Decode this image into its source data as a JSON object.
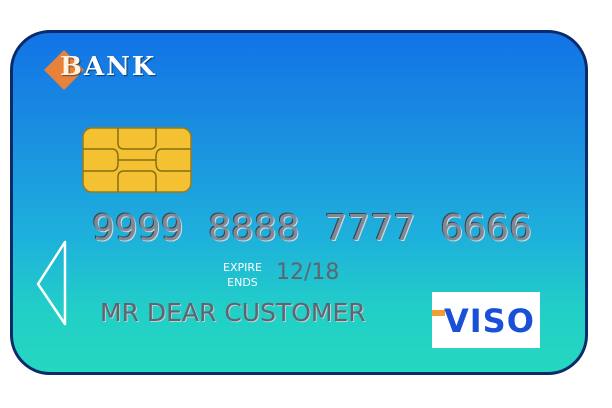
{
  "bank": {
    "first_letter": "B",
    "rest": "ANK",
    "diamond_color": "#e8823a"
  },
  "card": {
    "number_groups": [
      "9999",
      "8888",
      "7777",
      "6666"
    ],
    "expire_label_line1": "EXPIRE",
    "expire_label_line2": "ENDS",
    "expiry": "12/18",
    "holder": "MR DEAR CUSTOMER"
  },
  "network": {
    "name": "VISO",
    "text_color": "#1a4fd8",
    "accent_color": "#f0a030"
  },
  "icons": {
    "chip": "chip-icon",
    "arrow": "left-arrow-icon",
    "diamond": "diamond-icon"
  }
}
